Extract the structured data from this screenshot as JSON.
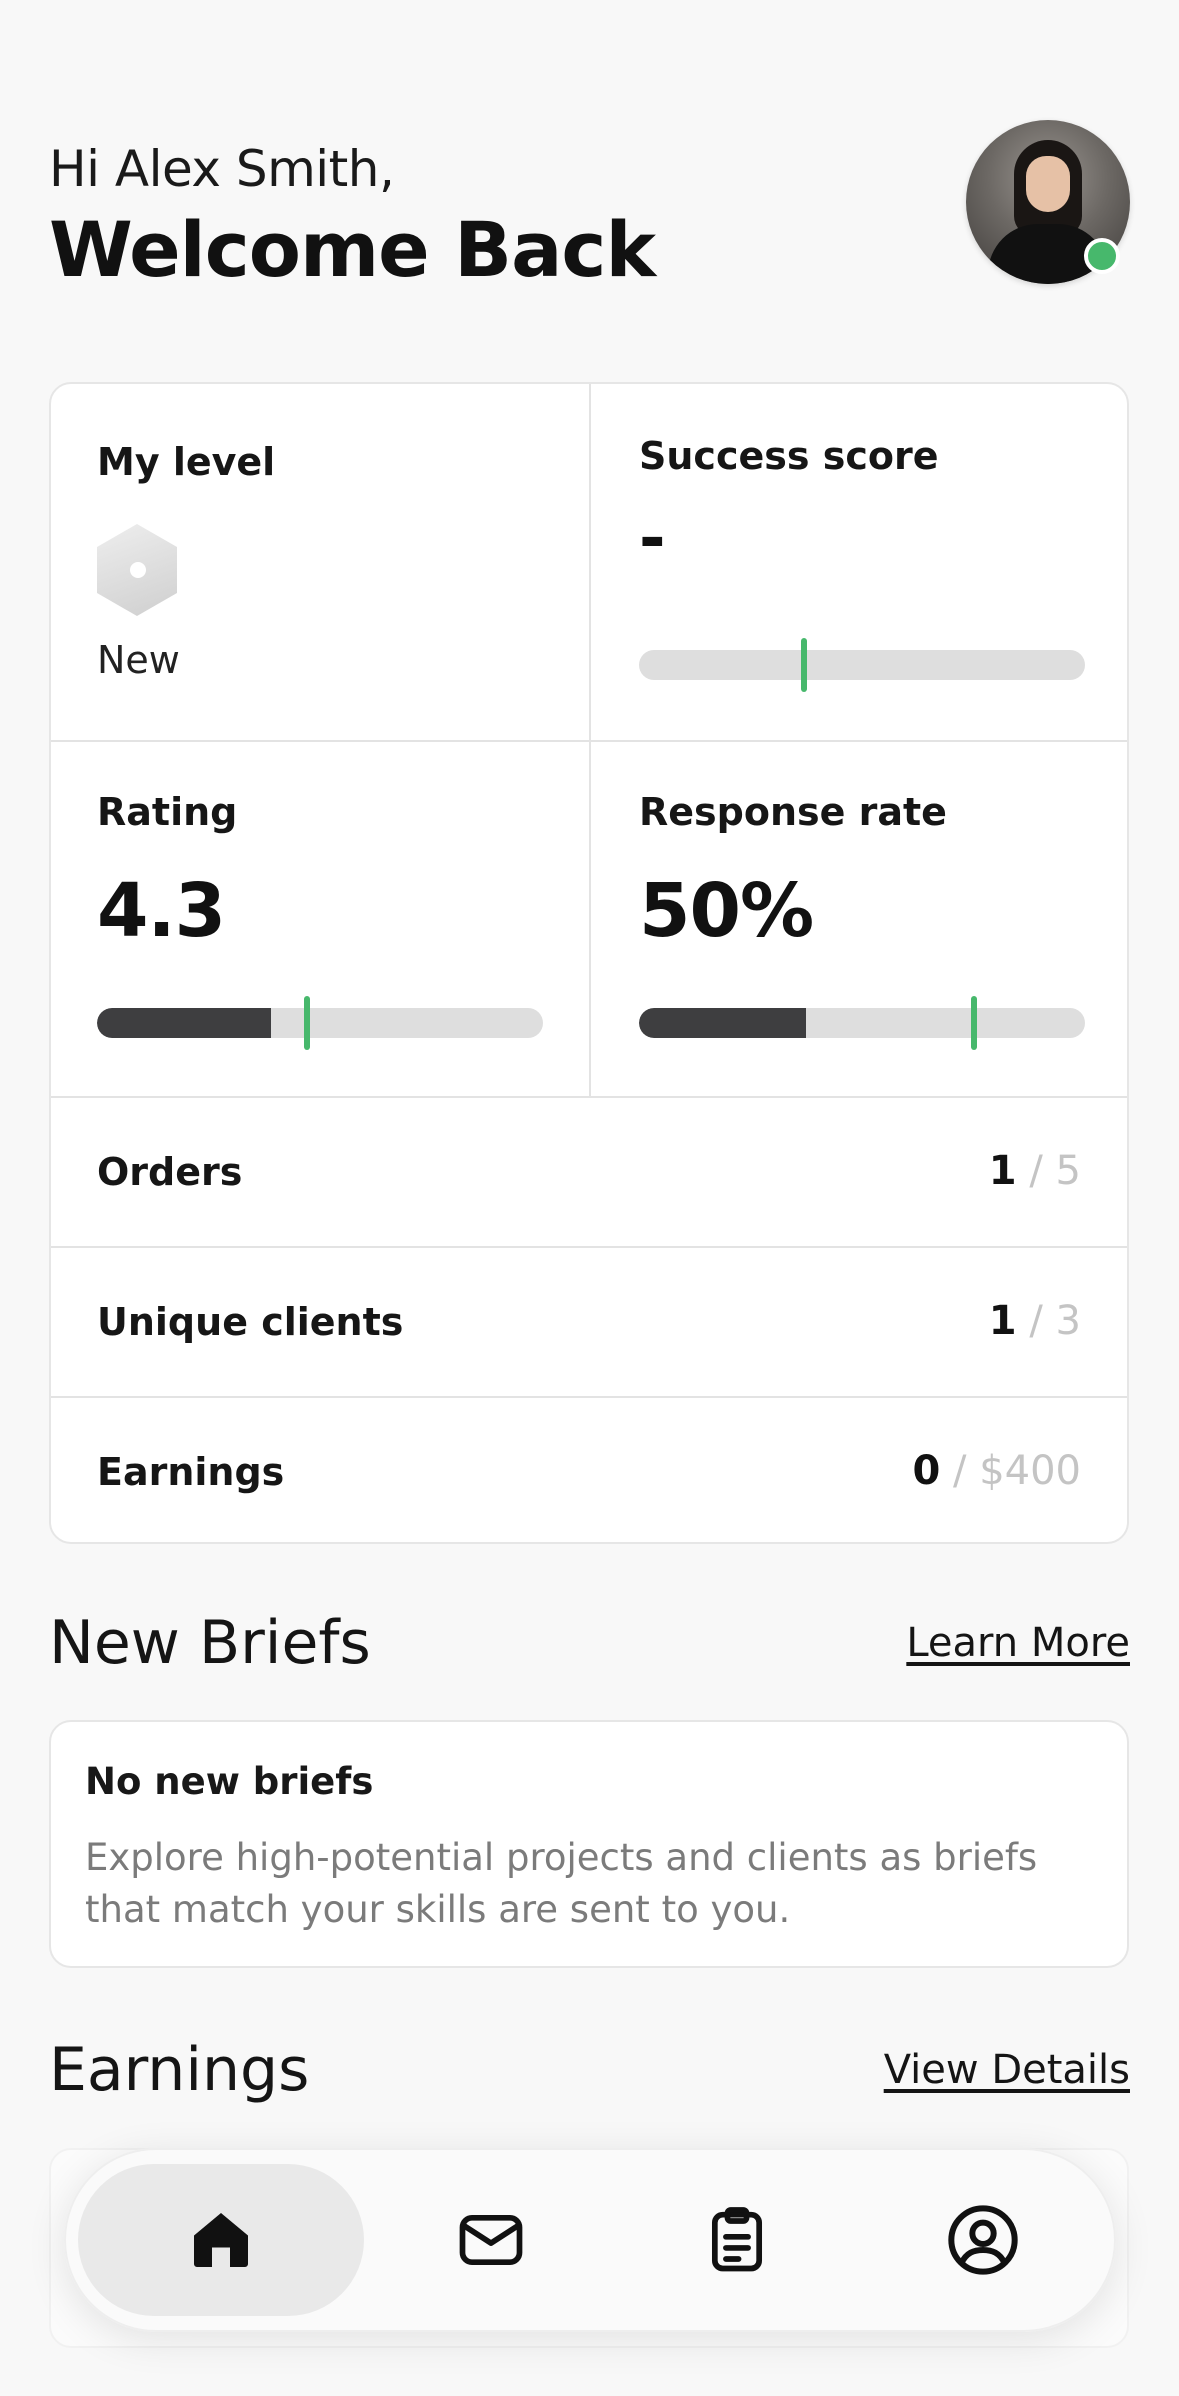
{
  "header": {
    "greeting": "Hi Alex Smith,",
    "welcome": "Welcome Back"
  },
  "stats": {
    "level": {
      "label": "My level",
      "value": "New"
    },
    "success_score": {
      "label": "Success score",
      "value": "-",
      "target_fraction": 0.37
    },
    "rating": {
      "label": "Rating",
      "value": "4.3",
      "fill_fraction": 0.39,
      "target_fraction": 0.47
    },
    "response_rate": {
      "label": "Response rate",
      "value": "50%",
      "fill_fraction": 0.375,
      "target_fraction": 0.75
    },
    "rows": [
      {
        "label": "Orders",
        "current": "1",
        "separator": "/",
        "max": "5"
      },
      {
        "label": "Unique clients",
        "current": "1",
        "separator": "/",
        "max": "3"
      },
      {
        "label": "Earnings",
        "current": "0",
        "separator": "/",
        "max": "$400"
      }
    ]
  },
  "briefs": {
    "title": "New Briefs",
    "link": "Learn More",
    "card_title": "No new briefs",
    "card_description": "Explore high-potential projects and clients as briefs that match your skills are sent to you."
  },
  "earnings": {
    "title": "Earnings",
    "link": "View Details"
  },
  "nav": {
    "items": [
      {
        "name": "home",
        "icon": "home-icon",
        "active": true
      },
      {
        "name": "messages",
        "icon": "mail-icon",
        "active": false
      },
      {
        "name": "orders",
        "icon": "clipboard-icon",
        "active": false
      },
      {
        "name": "profile",
        "icon": "user-circle-icon",
        "active": false
      }
    ]
  },
  "colors": {
    "accent_green": "#47b86c",
    "bar_fill": "#3e3e40",
    "bar_track": "#dedede"
  }
}
